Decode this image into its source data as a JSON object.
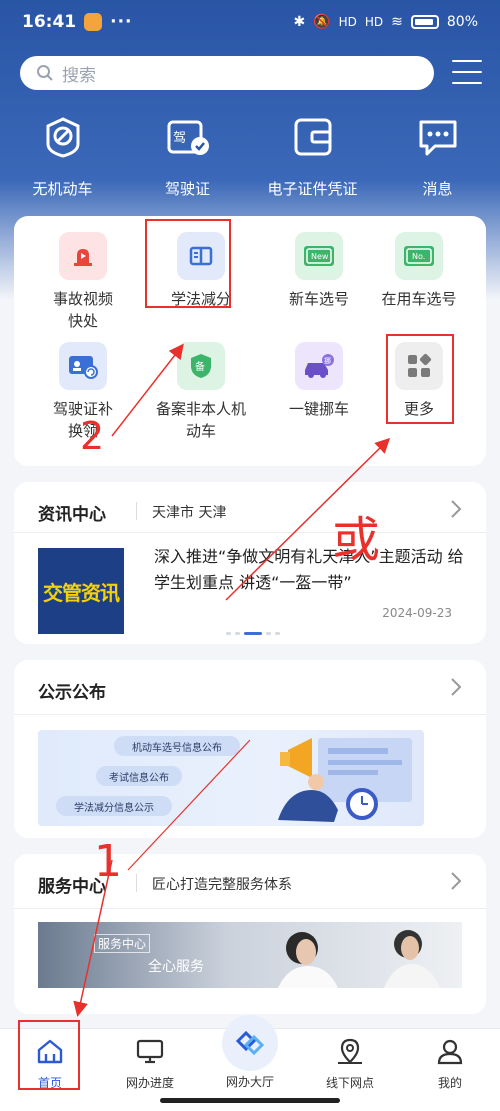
{
  "status_bar": {
    "time": "16:41",
    "dots": "···",
    "signal": "HD",
    "battery": "80%"
  },
  "search": {
    "placeholder": "搜索"
  },
  "quick_actions": [
    {
      "label": "无机动车",
      "icon": "no-vehicle-icon"
    },
    {
      "label": "驾驶证",
      "icon": "license-icon"
    },
    {
      "label": "电子证件凭证",
      "icon": "wallet-icon"
    },
    {
      "label": "消息",
      "icon": "message-icon"
    }
  ],
  "services": [
    {
      "label": "事故视频快处",
      "icon": "accident-video-icon"
    },
    {
      "label": "学法减分",
      "icon": "book-icon"
    },
    {
      "label": "新车选号",
      "icon": "new-plate-icon"
    },
    {
      "label": "在用车选号",
      "icon": "plate-icon"
    },
    {
      "label": "驾驶证补换领",
      "icon": "license-renew-icon"
    },
    {
      "label": "备案非本人机动车",
      "icon": "shield-icon"
    },
    {
      "label": "一键挪车",
      "icon": "move-car-icon"
    },
    {
      "label": "更多",
      "icon": "more-icon"
    }
  ],
  "news": {
    "title": "资讯中心",
    "city": "天津市 天津",
    "headline": "深入推进“争做文明有礼天津人”主题活动 给学生划重点 讲透“一盔一带”",
    "date": "2024-09-23",
    "thumb_text": "交管资讯"
  },
  "notice": {
    "title": "公示公布",
    "pills": [
      "机动车选号信息公布",
      "考试信息公布",
      "学法减分信息公示"
    ]
  },
  "service_center": {
    "title": "服务中心",
    "subtitle": "匠心打造完整服务体系",
    "banner_tag": "服务中心",
    "banner_text": "全心服务"
  },
  "bottom_nav": [
    {
      "label": "首页",
      "icon": "home-icon"
    },
    {
      "label": "网办进度",
      "icon": "monitor-icon"
    },
    {
      "label": "网办大厅",
      "icon": "hall-icon"
    },
    {
      "label": "线下网点",
      "icon": "map-pin-icon"
    },
    {
      "label": "我的",
      "icon": "profile-icon"
    }
  ],
  "annotations": {
    "step1": "1",
    "step2": "2",
    "or": "或"
  },
  "colors": {
    "brand": "#2a55a6",
    "accent": "#2a5bd7",
    "annotation": "#e8312c"
  }
}
